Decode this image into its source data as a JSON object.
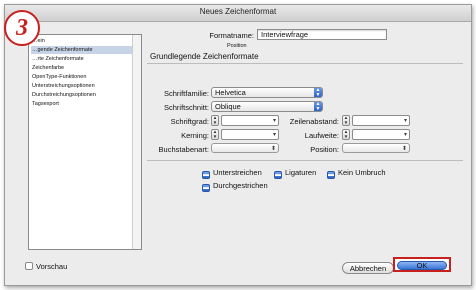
{
  "window": {
    "title": "Neues Zeichenformat"
  },
  "badge": {
    "number": "3"
  },
  "sidebar": {
    "items": [
      {
        "label": "…ein"
      },
      {
        "label": "…gende Zeichenformate",
        "selected": true
      },
      {
        "label": "…rte Zeichenformate"
      },
      {
        "label": "Zeichenfarbe"
      },
      {
        "label": "OpenType-Funktionen"
      },
      {
        "label": "Unterstreichungsoptionen"
      },
      {
        "label": "Durchstreichungsoptionen"
      },
      {
        "label": "Tagsexport"
      }
    ]
  },
  "form": {
    "name_label": "Formatname:",
    "name_value": "Interviewfrage",
    "position_caption": "Position",
    "section_title": "Grundlegende Zeichenformate",
    "font_family_label": "Schriftfamilie:",
    "font_family_value": "Helvetica",
    "font_style_label": "Schriftschnitt:",
    "font_style_value": "Oblique",
    "size_label": "Schriftgrad:",
    "leading_label": "Zeilenabstand:",
    "kerning_label": "Kerning:",
    "tracking_label": "Laufweite:",
    "case_label": "Buchstabenart:",
    "position_label": "Position:"
  },
  "checkboxes": {
    "underline": {
      "label": "Unterstreichen",
      "checked": true
    },
    "ligatures": {
      "label": "Ligaturen",
      "checked": true
    },
    "nobreak": {
      "label": "Kein Umbruch",
      "checked": true
    },
    "strikethrough": {
      "label": "Durchgestrichen",
      "checked": true
    }
  },
  "footer": {
    "preview_label": "Vorschau",
    "preview_checked": false,
    "cancel_label": "Abbrechen",
    "ok_label": "OK"
  },
  "colors": {
    "highlight": "#c8201d",
    "accent": "#3a74d6",
    "selection": "#c7d3e6"
  }
}
